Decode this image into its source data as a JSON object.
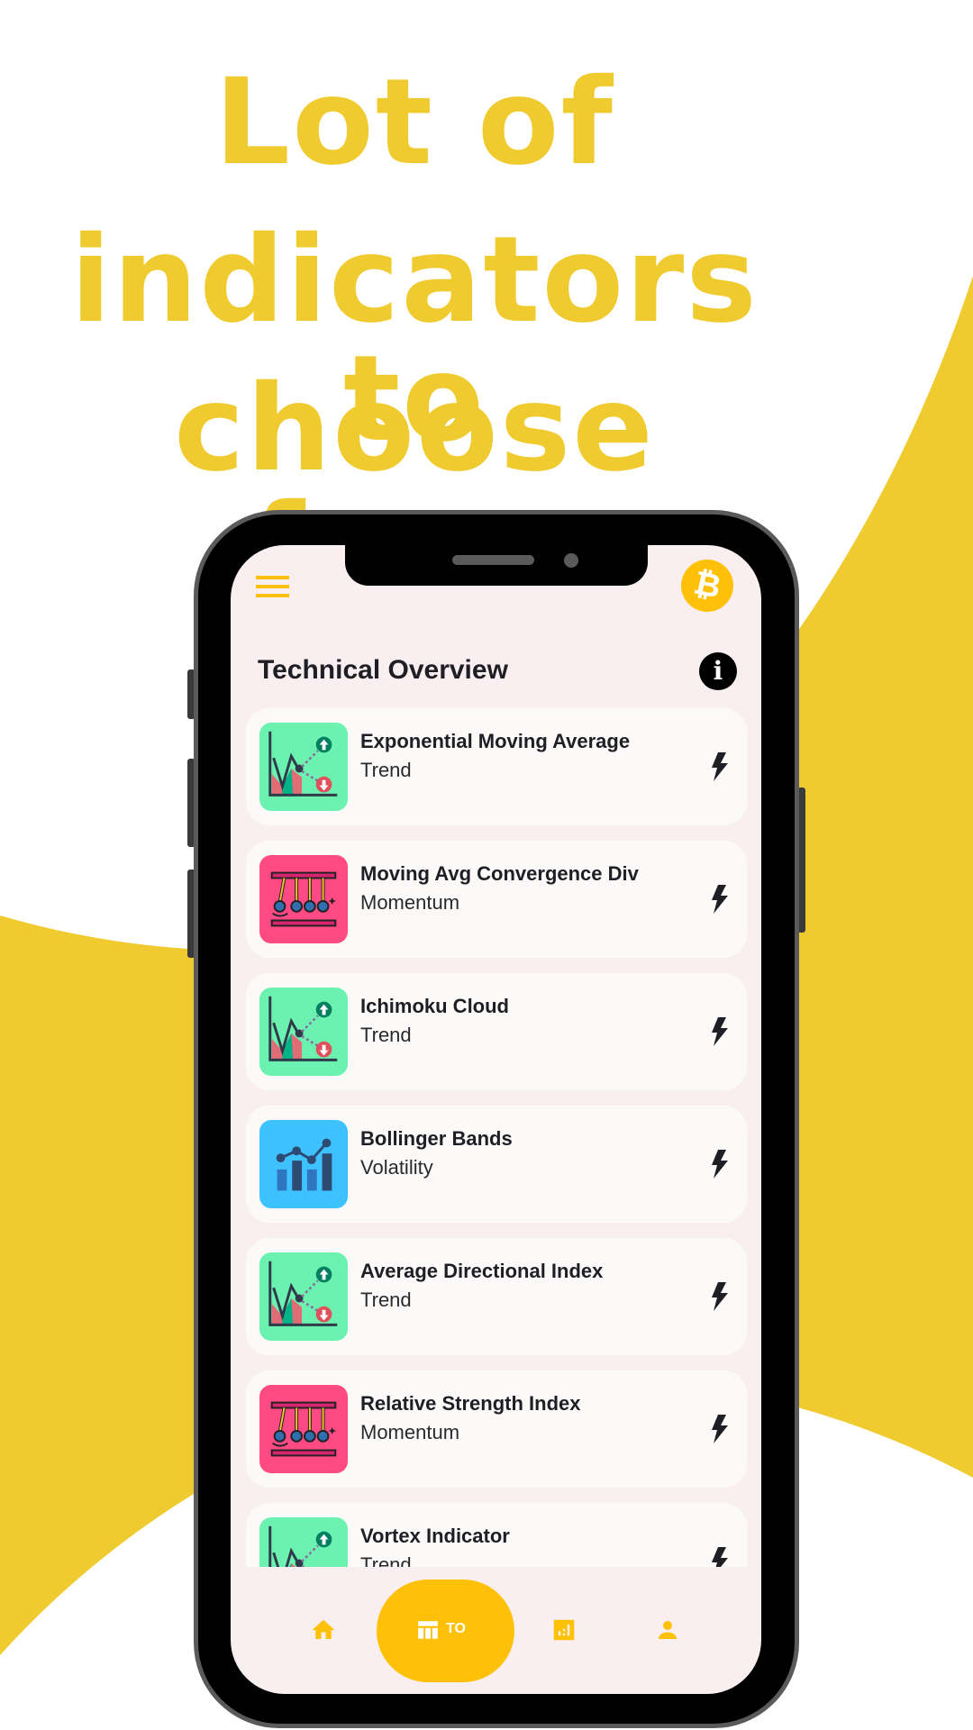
{
  "headline": [
    "Lot of",
    "indicators to",
    "choose from"
  ],
  "colors": {
    "accent": "#FFC107",
    "headline": "#F0CB2F",
    "screen_bg": "#F9EFF0",
    "card_bg": "#FCFAF9"
  },
  "app": {
    "menu_icon": "hamburger-icon",
    "currency_icon": "bitcoin-icon",
    "currency_symbol": "₿",
    "title": "Technical Overview",
    "info_symbol": "i"
  },
  "list": {
    "items": [
      {
        "title": "Exponential Moving Average",
        "category": "Trend",
        "icon": "trend"
      },
      {
        "title": "Moving Avg Convergence Div",
        "category": "Momentum",
        "icon": "momentum"
      },
      {
        "title": "Ichimoku Cloud",
        "category": "Trend",
        "icon": "trend"
      },
      {
        "title": "Bollinger Bands",
        "category": "Volatility",
        "icon": "volatility"
      },
      {
        "title": "Average Directional Index",
        "category": "Trend",
        "icon": "trend"
      },
      {
        "title": "Relative Strength Index",
        "category": "Momentum",
        "icon": "momentum"
      },
      {
        "title": "Vortex Indicator",
        "category": "Trend",
        "icon": "trend"
      }
    ]
  },
  "nav": {
    "items": [
      "home",
      "technical-overview",
      "charts",
      "profile"
    ],
    "active_label": "TO"
  }
}
